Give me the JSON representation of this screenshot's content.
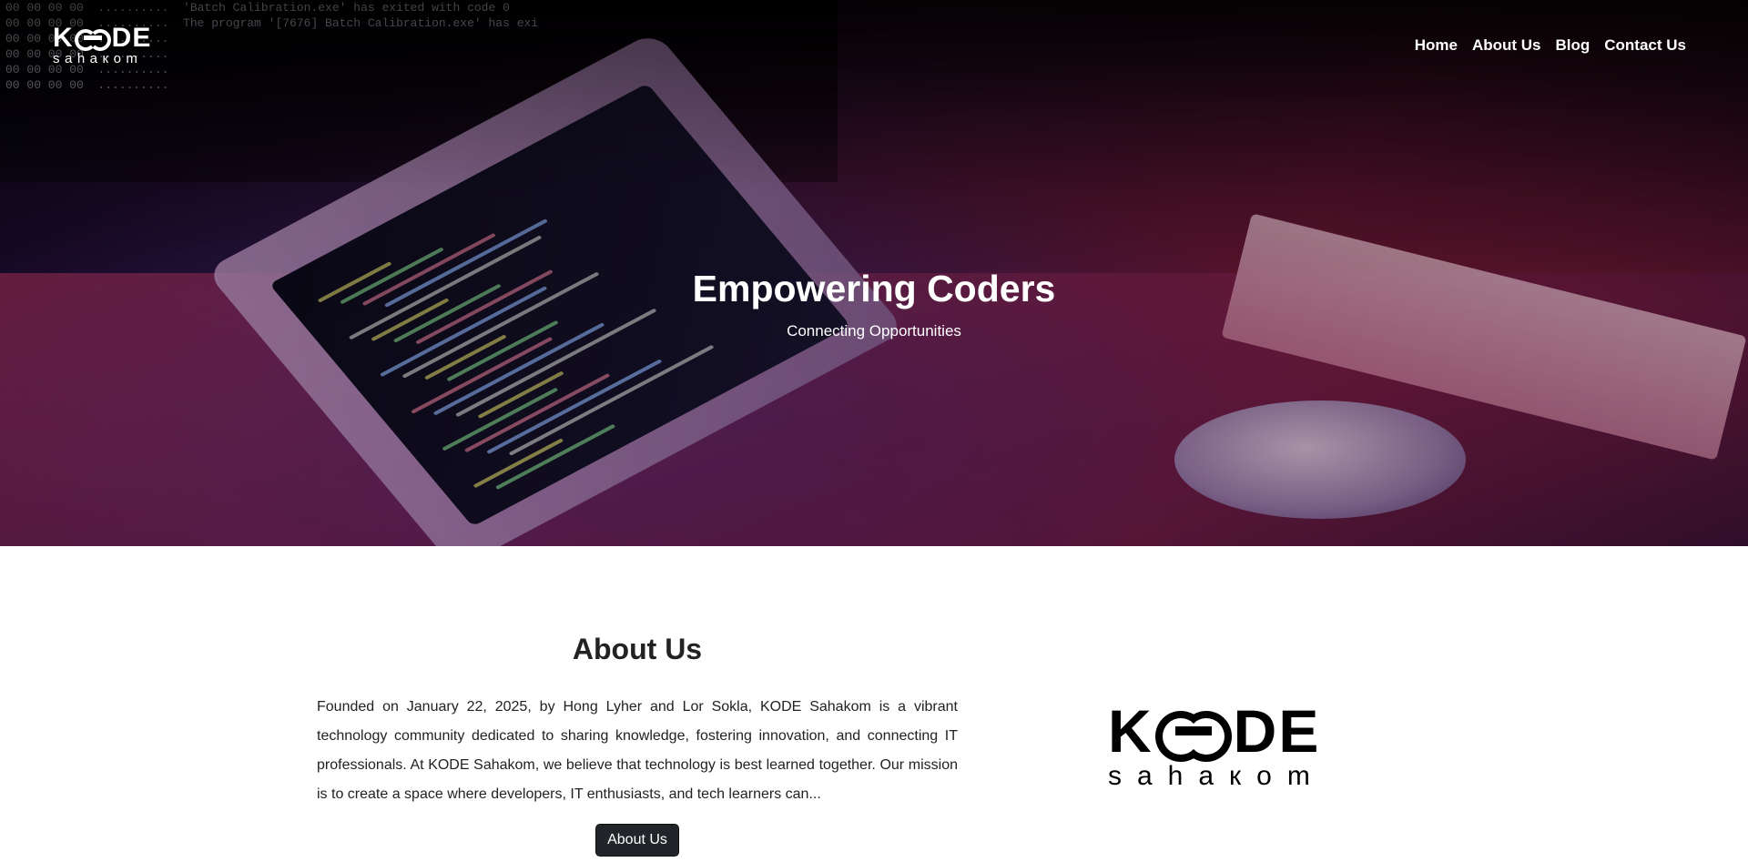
{
  "header": {
    "logo": {
      "main_left": "K",
      "main_right": "DE",
      "sub": "sahaкom"
    },
    "nav": [
      {
        "label": "Home"
      },
      {
        "label": "About Us"
      },
      {
        "label": "Blog"
      },
      {
        "label": "Contact Us"
      }
    ]
  },
  "hero": {
    "title": "Empowering Coders",
    "subtitle": "Connecting Opportunities",
    "terminal_lines": [
      "00 00 00 00  ..........  'Batch Calibration.exe' has exited with code 0",
      "00 00 00 00  ..........  The program '[7676] Batch Calibration.exe' has exi",
      "00 00 00 00  ..........",
      "00 00 00 00  ..........",
      "00 00 00 00  ..........",
      "00 00 00 00  .........."
    ]
  },
  "about": {
    "heading": "About Us",
    "paragraph": "Founded on January 22, 2025, by Hong Lyher and Lor Sokla, KODE Sahakom is a vibrant technology community dedicated to sharing knowledge, fostering innovation, and connecting IT professionals. At KODE Sahakom, we believe that technology is best learned together. Our mission is to create a space where developers, IT enthusiasts, and tech learners can...",
    "button_label": "About Us",
    "logo": {
      "main_left": "K",
      "main_right": "DE",
      "sub": "sahaкom"
    }
  },
  "colors": {
    "button_bg": "#212529",
    "nav_text": "#ffffff",
    "hero_pink": "#a8244f",
    "hero_purple": "#3b2a8a"
  }
}
